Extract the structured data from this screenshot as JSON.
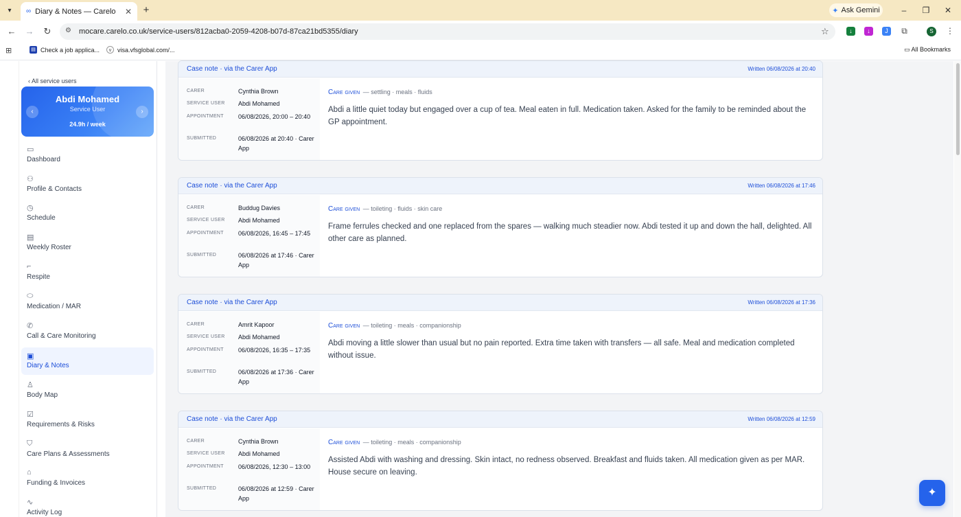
{
  "browser": {
    "tab_title": "Diary & Notes — Carelo",
    "tab_close": "✕",
    "new_tab": "+",
    "gemini_label": "Ask Gemini",
    "url": "mocare.carelo.co.uk/service-users/812acba0-2059-4208-b07d-87ca21bd5355/diary",
    "bookmarks": [
      "Check a job applica...",
      "visa.vfsglobal.com/..."
    ],
    "all_bookmarks": "All Bookmarks",
    "profile_initial": "S"
  },
  "sidebar": {
    "back_link": "‹ All service users",
    "service_user": {
      "name": "Abdi Mohamed",
      "role": "Service User",
      "hours": "24.9h / week"
    },
    "nav": [
      {
        "label": "Dashboard",
        "icon": "calendar-icon"
      },
      {
        "label": "Profile & Contacts",
        "icon": "user-icon"
      },
      {
        "label": "Schedule",
        "icon": "clock-icon"
      },
      {
        "label": "Weekly Roster",
        "icon": "roster-icon"
      },
      {
        "label": "Respite",
        "icon": "bed-icon"
      },
      {
        "label": "Medication / MAR",
        "icon": "pill-icon"
      },
      {
        "label": "Call & Care Monitoring",
        "icon": "phone-icon"
      },
      {
        "label": "Diary & Notes",
        "icon": "notes-icon",
        "active": true
      },
      {
        "label": "Body Map",
        "icon": "body-icon"
      },
      {
        "label": "Requirements & Risks",
        "icon": "checkbox-icon"
      },
      {
        "label": "Care Plans & Assessments",
        "icon": "shield-icon"
      },
      {
        "label": "Funding & Invoices",
        "icon": "bank-icon"
      },
      {
        "label": "Activity Log",
        "icon": "pulse-icon"
      }
    ]
  },
  "labels": {
    "carer": "CARER",
    "service_user": "SERVICE USER",
    "appointment": "APPOINTMENT",
    "submitted": "SUBMITTED",
    "care_given": "Care given"
  },
  "notes": [
    {
      "title": "Case note · via the Carer App",
      "written": "Written 06/08/2026 at 20:40",
      "carer": "Cynthia Brown",
      "service_user": "Abdi Mohamed",
      "appointment": "06/08/2026, 20:00 – 20:40",
      "submitted": "06/08/2026 at 20:40 · Carer App",
      "tags": "— settling · meals · fluids",
      "text": "Abdi a little quiet today but engaged over a cup of tea. Meal eaten in full. Medication taken. Asked for the family to be reminded about the GP appointment."
    },
    {
      "title": "Case note · via the Carer App",
      "written": "Written 06/08/2026 at 17:46",
      "carer": "Buddug Davies",
      "service_user": "Abdi Mohamed",
      "appointment": "06/08/2026, 16:45 – 17:45",
      "submitted": "06/08/2026 at 17:46 · Carer App",
      "tags": "— toileting · fluids · skin care",
      "text": "Frame ferrules checked and one replaced from the spares — walking much steadier now. Abdi tested it up and down the hall, delighted. All other care as planned."
    },
    {
      "title": "Case note · via the Carer App",
      "written": "Written 06/08/2026 at 17:36",
      "carer": "Amrit Kapoor",
      "service_user": "Abdi Mohamed",
      "appointment": "06/08/2026, 16:35 – 17:35",
      "submitted": "06/08/2026 at 17:36 · Carer App",
      "tags": "— toileting · meals · companionship",
      "text": "Abdi moving a little slower than usual but no pain reported. Extra time taken with transfers — all safe. Meal and medication completed without issue."
    },
    {
      "title": "Case note · via the Carer App",
      "written": "Written 06/08/2026 at 12:59",
      "carer": "Cynthia Brown",
      "service_user": "Abdi Mohamed",
      "appointment": "06/08/2026, 12:30 – 13:00",
      "submitted": "06/08/2026 at 12:59 · Carer App",
      "tags": "— toileting · meals · companionship",
      "text": "Assisted Abdi with washing and dressing. Skin intact, no redness observed. Breakfast and fluids taken. All medication given as per MAR. House secure on leaving."
    }
  ],
  "fab_icon": "sparkle-icon"
}
